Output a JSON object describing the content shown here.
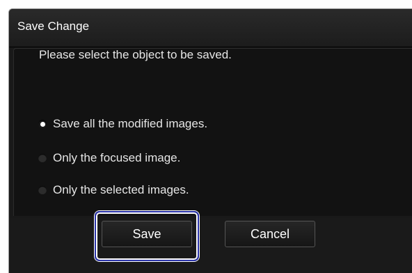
{
  "dialog": {
    "title": "Save Change",
    "prompt": "Please select the object to be saved.",
    "options": [
      {
        "label": "Save all the modified images.",
        "selected": true
      },
      {
        "label": "Only the focused image.",
        "selected": false
      },
      {
        "label": "Only the selected images.",
        "selected": false
      }
    ],
    "buttons": {
      "save_label": "Save",
      "cancel_label": "Cancel"
    }
  },
  "colors": {
    "background": "#191919",
    "text": "#e6e6e6",
    "focus_ring": "#2a33a8"
  }
}
